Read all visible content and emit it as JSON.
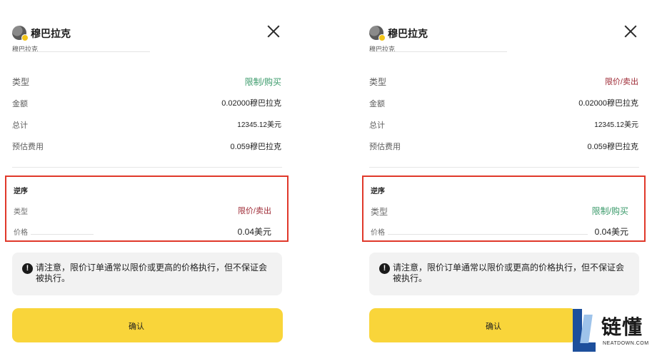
{
  "panels": [
    {
      "coin_title": "穆巴拉克",
      "coin_subtitle": "穆巴拉克",
      "rows": [
        {
          "label": "类型",
          "value": "限制/购买"
        },
        {
          "label": "金额",
          "value": "0.02000穆巴拉克"
        },
        {
          "label": "总计",
          "value": "12345.12美元"
        },
        {
          "label": "预估费用",
          "value": "0.059穆巴拉克"
        }
      ],
      "reverse": {
        "title": "逆序",
        "type_label": "类型",
        "type_value": "限价/卖出",
        "price_label": "价格",
        "price_value": "0.04美元"
      },
      "notice": "请注意，限价订单通常以限价或更高的价格执行，但不保证会被执行。",
      "confirm_label": "确认"
    },
    {
      "coin_title": "穆巴拉克",
      "coin_subtitle": "穆巴拉克",
      "rows": [
        {
          "label": "类型",
          "value": "限价/卖出"
        },
        {
          "label": "金额",
          "value": "0.02000穆巴拉克"
        },
        {
          "label": "总计",
          "value": "12345.12美元"
        },
        {
          "label": "预估费用",
          "value": "0.059穆巴拉克"
        }
      ],
      "reverse": {
        "title": "逆序",
        "type_label": "类型",
        "type_value": "限制/购买",
        "price_label": "价格",
        "price_value": "0.04美元"
      },
      "notice": "请注意，限价订单通常以限价或更高的价格执行，但不保证会被执行。",
      "confirm_label": "确认"
    }
  ],
  "watermark": {
    "name": "链懂",
    "domain": "NEATDOWN.COM"
  },
  "colors": {
    "buy": "#3a9a6a",
    "sell": "#9e2a35",
    "highlight_border": "#e0382a",
    "confirm_button": "#f9d53a"
  },
  "icons": [
    "coin-icon",
    "close-icon",
    "warning-icon",
    "neatdown-logo"
  ]
}
